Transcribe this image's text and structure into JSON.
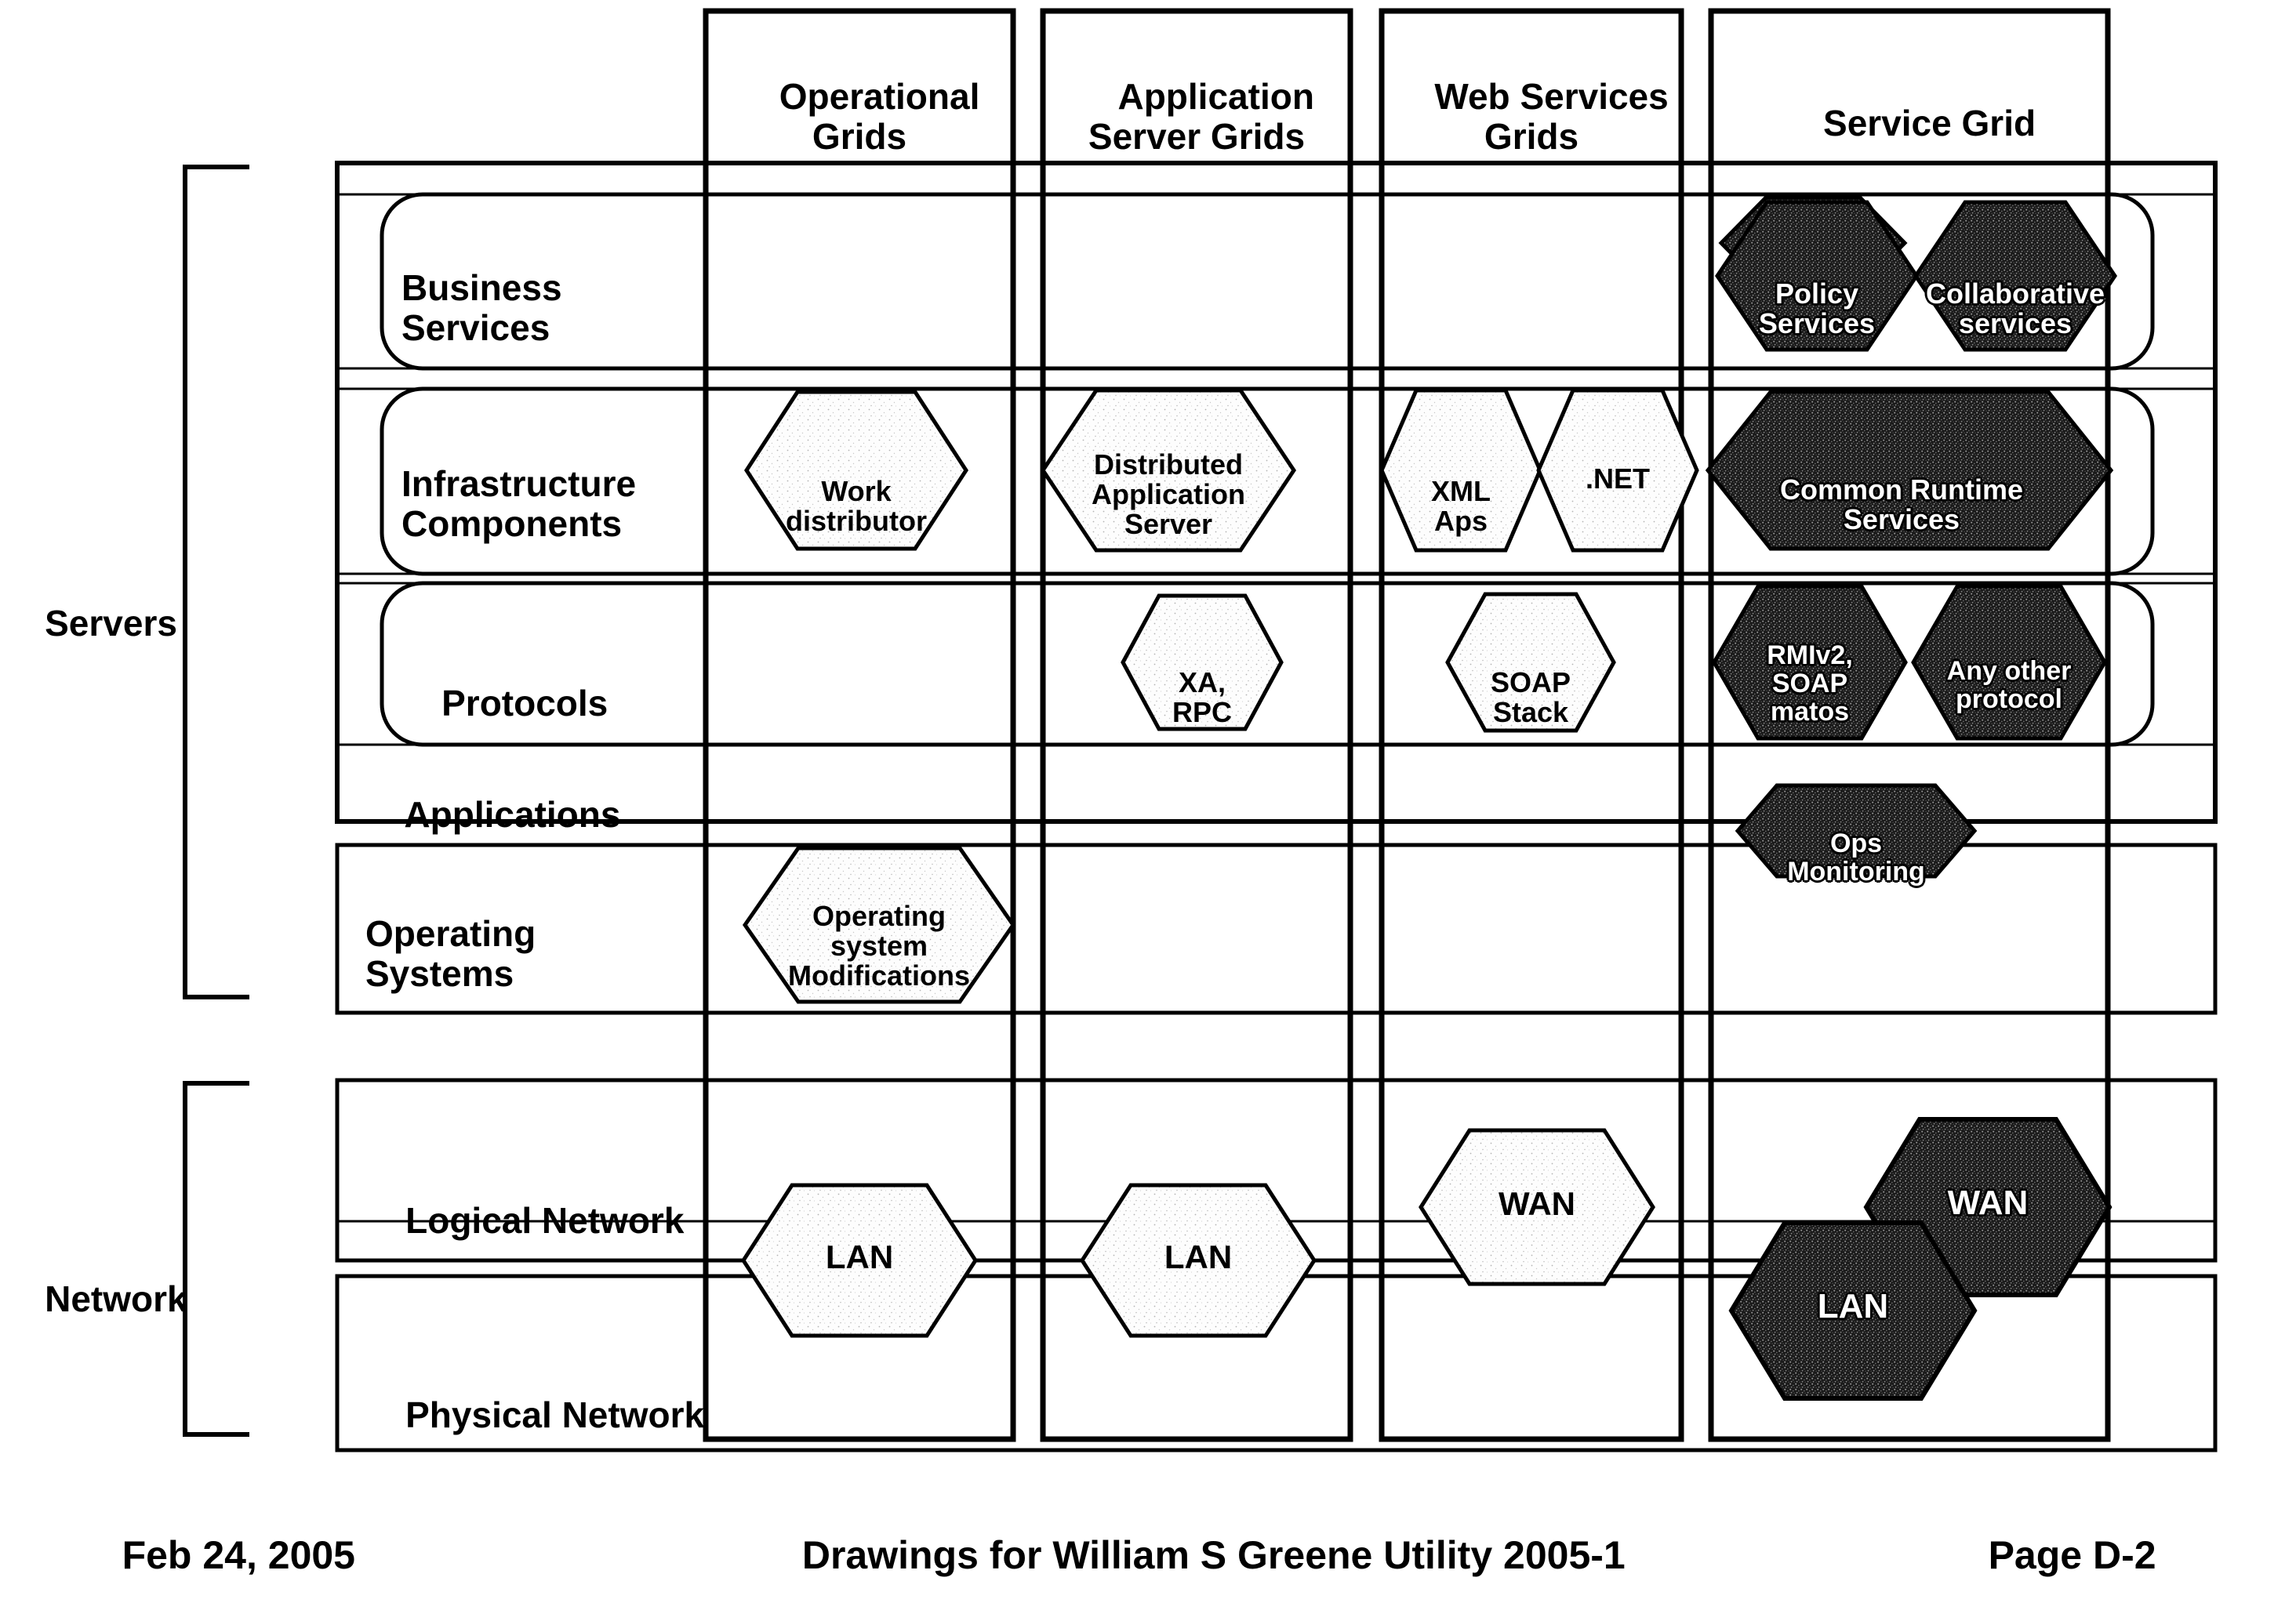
{
  "columns": [
    {
      "id": "operational-grids",
      "label": "Operational\nGrids"
    },
    {
      "id": "application-server-grids",
      "label": "Application\nServer Grids"
    },
    {
      "id": "web-services-grids",
      "label": "Web Services\nGrids"
    },
    {
      "id": "service-grid",
      "label": "Service Grid"
    }
  ],
  "group_brackets": [
    {
      "id": "servers",
      "label": "Servers"
    },
    {
      "id": "network",
      "label": "Network"
    }
  ],
  "rows": [
    {
      "id": "business-services",
      "label": "Business\nServices"
    },
    {
      "id": "infrastructure-components",
      "label": "Infrastructure\nComponents"
    },
    {
      "id": "protocols",
      "label": "Protocols"
    },
    {
      "id": "applications",
      "label": "Applications"
    },
    {
      "id": "operating-systems",
      "label": "Operating\nSystems"
    },
    {
      "id": "logical-network",
      "label": "Logical Network"
    },
    {
      "id": "physical-network",
      "label": "Physical Network"
    }
  ],
  "nodes": [
    {
      "id": "policy-services",
      "label": "Policy\nServices",
      "column": "service-grid",
      "row": "business-services",
      "fill": "dark"
    },
    {
      "id": "collaborative-services",
      "label": "Collaborative\nservices",
      "column": "service-grid",
      "row": "business-services",
      "fill": "dark"
    },
    {
      "id": "work-distributor",
      "label": "Work\ndistributor",
      "column": "operational-grids",
      "row": "infrastructure-components",
      "fill": "light"
    },
    {
      "id": "distributed-application-server",
      "label": "Distributed\nApplication\nServer",
      "column": "application-server-grids",
      "row": "infrastructure-components",
      "fill": "light"
    },
    {
      "id": "xml-aps",
      "label": "XML\nAps",
      "column": "web-services-grids",
      "row": "infrastructure-components",
      "fill": "light"
    },
    {
      "id": "dotnet",
      "label": ".NET",
      "column": "web-services-grids",
      "row": "infrastructure-components",
      "fill": "light"
    },
    {
      "id": "common-runtime-services",
      "label": "Common Runtime\nServices",
      "column": "service-grid",
      "row": "infrastructure-components",
      "fill": "dark"
    },
    {
      "id": "xa-rpc",
      "label": "XA,\nRPC",
      "column": "application-server-grids",
      "row": "protocols",
      "fill": "light"
    },
    {
      "id": "soap-stack",
      "label": "SOAP\nStack",
      "column": "web-services-grids",
      "row": "protocols",
      "fill": "light"
    },
    {
      "id": "rmiv2-soap-matos",
      "label": "RMIv2,\nSOAP\nmatos",
      "column": "service-grid",
      "row": "protocols",
      "fill": "dark"
    },
    {
      "id": "any-other-protocol",
      "label": "Any other\nprotocol",
      "column": "service-grid",
      "row": "protocols",
      "fill": "dark"
    },
    {
      "id": "ops-monitoring",
      "label": "Ops\nMonitoring",
      "column": "service-grid",
      "row": "applications",
      "fill": "dark"
    },
    {
      "id": "operating-system-modifications",
      "label": "Operating\nsystem\nModifications",
      "column": "operational-grids",
      "row": "operating-systems",
      "fill": "light"
    },
    {
      "id": "lan-operational",
      "label": "LAN",
      "column": "operational-grids",
      "row": "physical-network",
      "fill": "light"
    },
    {
      "id": "lan-appserver",
      "label": "LAN",
      "column": "application-server-grids",
      "row": "physical-network",
      "fill": "light"
    },
    {
      "id": "wan-webservices",
      "label": "WAN",
      "column": "web-services-grids",
      "row": "logical-network",
      "fill": "light"
    },
    {
      "id": "lan-servicegrid",
      "label": "LAN",
      "column": "service-grid",
      "row": "physical-network",
      "fill": "dark"
    },
    {
      "id": "wan-servicegrid",
      "label": "WAN",
      "column": "service-grid",
      "row": "logical-network",
      "fill": "dark"
    }
  ],
  "footer": {
    "date": "Feb 24, 2005",
    "title": "Drawings for William S Greene Utility 2005-1",
    "page": "Page D-2"
  },
  "colors": {
    "stroke": "#000000",
    "background": "#ffffff",
    "dark_fill": "#2b2b2b",
    "light_fill": "#fcfcfc"
  }
}
